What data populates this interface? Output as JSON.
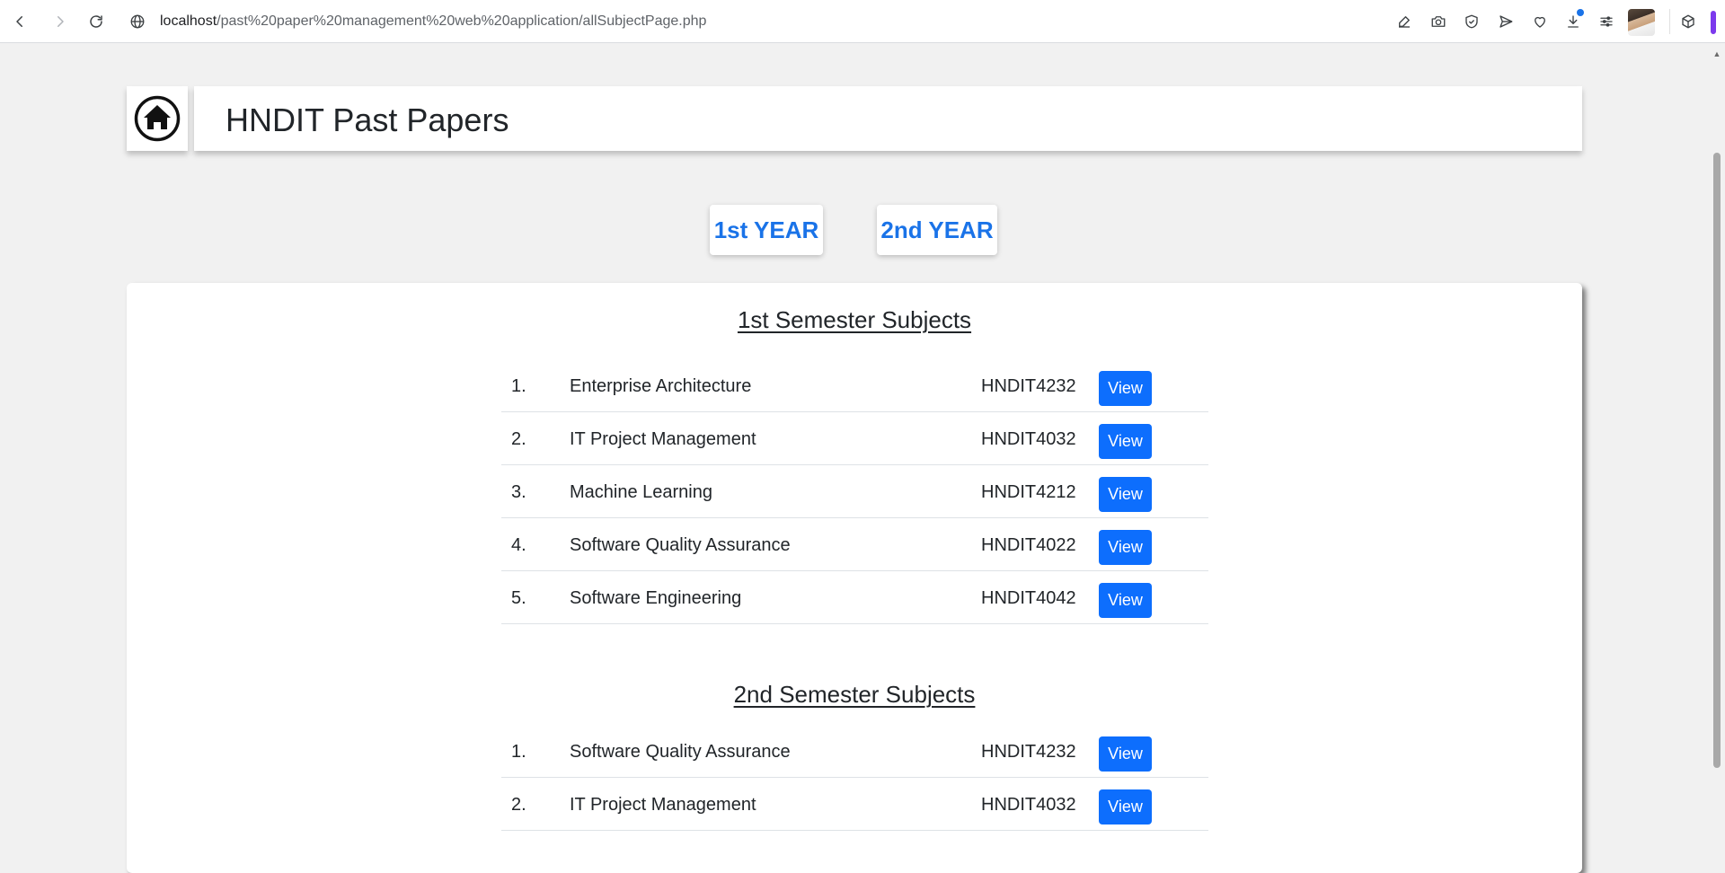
{
  "browser": {
    "url_host": "localhost",
    "url_path": "/past%20paper%20management%20web%20application/allSubjectPage.php",
    "icons": [
      "back-icon",
      "forward-icon",
      "reload-icon",
      "site-info-icon",
      "edit-icon",
      "camera-icon",
      "shield-check-icon",
      "send-icon",
      "heart-icon",
      "download-icon",
      "menu-icon",
      "profile-avatar",
      "extension-cube-icon"
    ]
  },
  "header": {
    "title": "HNDIT Past Papers",
    "home_icon": "home-icon"
  },
  "years": {
    "first": "1st YEAR",
    "second": "2nd YEAR"
  },
  "colors": {
    "accent_blue": "#1a73e8",
    "button_blue": "#0d6efd",
    "page_bg": "#f1f1f1"
  },
  "semesters": [
    {
      "title": "1st Semester Subjects",
      "subjects": [
        {
          "num": "1.",
          "name": "Enterprise Architecture",
          "code": "HNDIT4232",
          "action": "View"
        },
        {
          "num": "2.",
          "name": "IT Project Management",
          "code": "HNDIT4032",
          "action": "View"
        },
        {
          "num": "3.",
          "name": "Machine Learning",
          "code": "HNDIT4212",
          "action": "View"
        },
        {
          "num": "4.",
          "name": "Software Quality Assurance",
          "code": "HNDIT4022",
          "action": "View"
        },
        {
          "num": "5.",
          "name": "Software Engineering",
          "code": "HNDIT4042",
          "action": "View"
        }
      ]
    },
    {
      "title": "2nd Semester Subjects",
      "subjects": [
        {
          "num": "1.",
          "name": "Software Quality Assurance",
          "code": "HNDIT4232",
          "action": "View"
        },
        {
          "num": "2.",
          "name": "IT Project Management",
          "code": "HNDIT4032",
          "action": "View"
        }
      ]
    }
  ]
}
